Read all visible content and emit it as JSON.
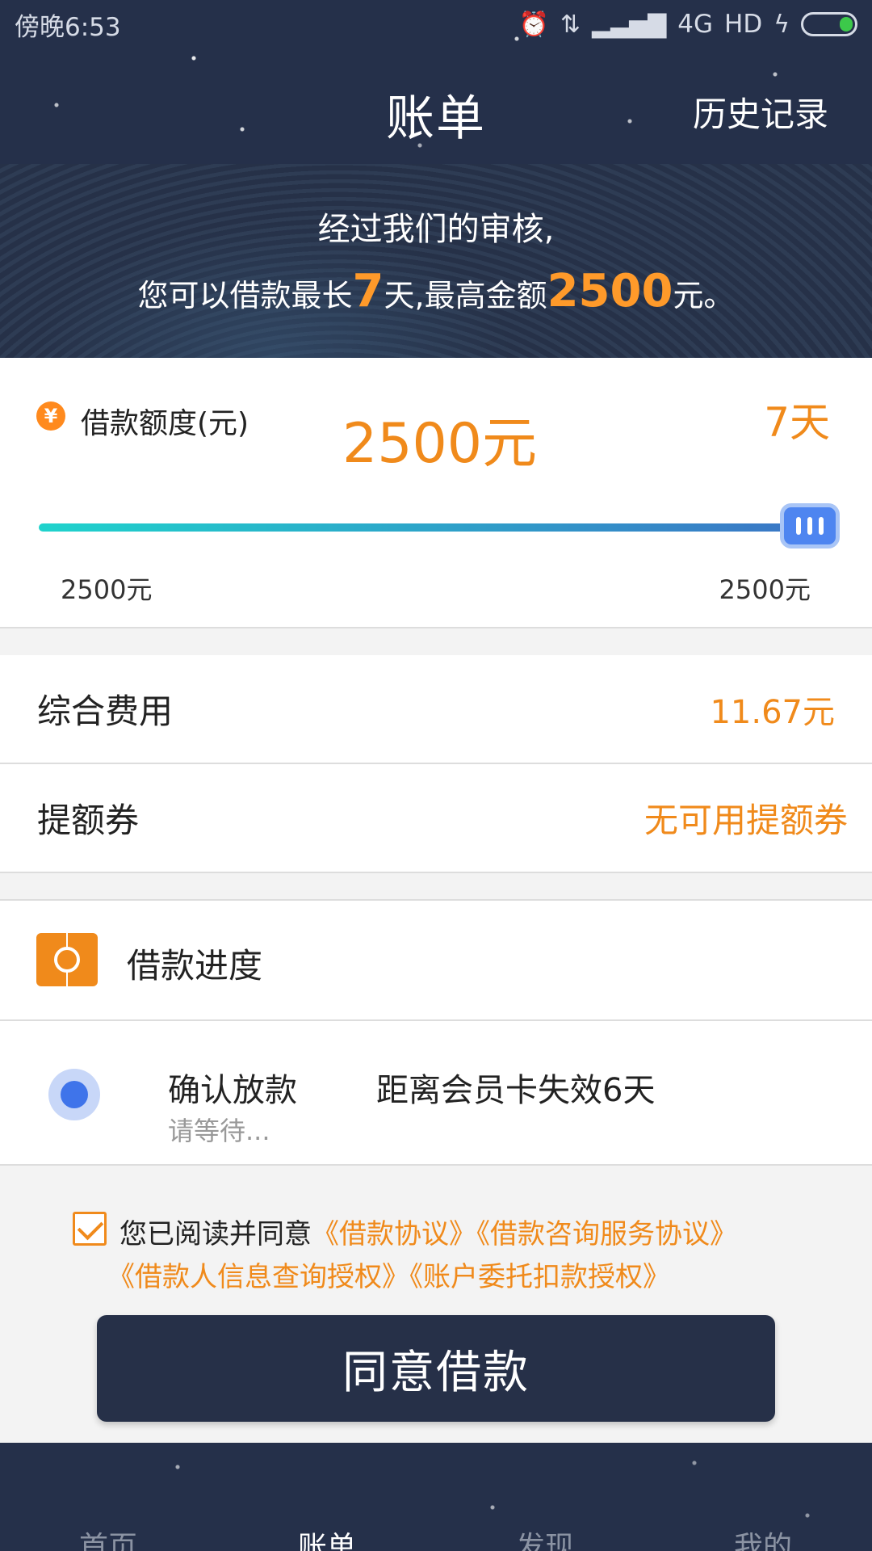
{
  "status_bar": {
    "time": "傍晚6:53",
    "network": "4G",
    "hd": "HD",
    "icons": [
      "alarm-icon",
      "data-transfer-icon",
      "signal-icon",
      "charging-icon",
      "battery-icon"
    ],
    "battery_color": "#3cc94a"
  },
  "header": {
    "title": "账单",
    "history_link": "历史记录"
  },
  "banner": {
    "line1": "经过我们的审核,",
    "line2_prefix": "您可以借款最长",
    "max_days": "7",
    "line2_middle": "天,最高金额",
    "max_amount": "2500",
    "line2_suffix": "元。"
  },
  "loan": {
    "icon_symbol": "¥",
    "label": "借款额度(元)",
    "amount": "2500元",
    "days": "7天",
    "slider_min_label": "2500元",
    "slider_max_label": "2500元",
    "slider_value_fraction": 1.0
  },
  "fees": {
    "total_label": "综合费用",
    "total_value": "11.67元",
    "coupon_label": "提额券",
    "coupon_value": "无可用提额券"
  },
  "progress": {
    "title": "借款进度",
    "step_title": "确认放款",
    "step_note": "距离会员卡失效6天",
    "step_sub": "请等待..."
  },
  "agreement": {
    "checked": true,
    "prefix": "您已阅读并同意",
    "links_line1": [
      "《借款协议》",
      "《借款咨询服务协议》"
    ],
    "links_line2": [
      "《借款人信息查询授权》",
      "《账户委托扣款授权》"
    ]
  },
  "action": {
    "agree_button": "同意借款"
  },
  "bottom_nav": {
    "items": [
      {
        "label": "首页",
        "active": false
      },
      {
        "label": "账单",
        "active": true
      },
      {
        "label": "发现",
        "active": false
      },
      {
        "label": "我的",
        "active": false
      }
    ]
  },
  "colors": {
    "navy": "#25304a",
    "accent": "#f08a1b",
    "slider_start": "#1fd3cc",
    "slider_end": "#3b74c6",
    "thumb": "#4e85f0"
  }
}
